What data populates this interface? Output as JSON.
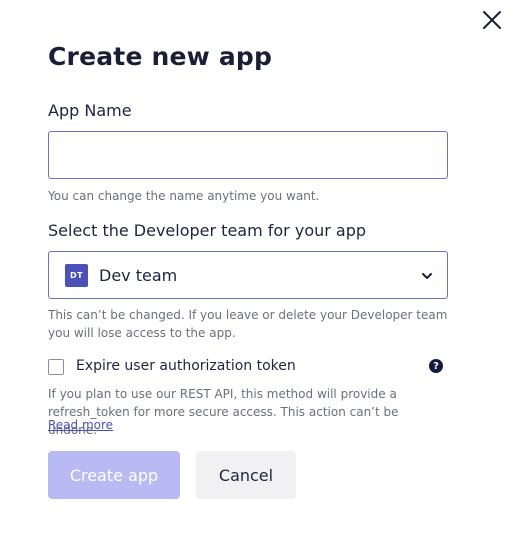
{
  "dialog": {
    "title": "Create new app"
  },
  "app_name": {
    "label": "App Name",
    "value": "",
    "placeholder": "",
    "hint": "You can change the name anytime you want."
  },
  "developer_team": {
    "label": "Select the Developer team for your app",
    "selected_initials": "DT",
    "selected_name": "Dev team",
    "hint": "This can’t be changed. If you leave or delete your Developer team you will lose access to the app."
  },
  "expire_token": {
    "checked": false,
    "label": "Expire user authorization token",
    "help_glyph": "?",
    "hint": "If you plan to use our REST API, this method will provide a refresh_token for more secure access. This action can’t be undone.",
    "link": "Read more"
  },
  "actions": {
    "primary_label": "Create app",
    "primary_disabled": true,
    "secondary_label": "Cancel"
  },
  "colors": {
    "accent": "#4b51b8",
    "primary_disabled_bg": "#b7baf3",
    "text": "#1f2340",
    "muted": "#6b6f80"
  }
}
